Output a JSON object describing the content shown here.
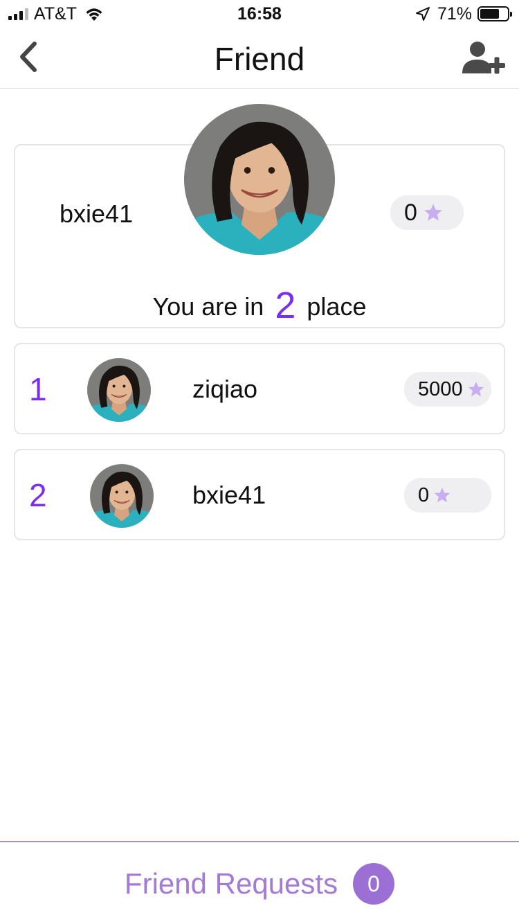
{
  "status_bar": {
    "carrier": "AT&T",
    "time": "16:58",
    "battery_percent": "71%",
    "battery_level": 0.71,
    "signal_icon": "signal-bars-icon",
    "wifi_icon": "wifi-icon",
    "location_icon": "location-arrow-icon",
    "battery_icon": "battery-icon"
  },
  "nav": {
    "title": "Friend",
    "back_icon": "chevron-left-icon",
    "add_icon": "add-user-icon"
  },
  "me": {
    "name": "bxie41",
    "score": "0",
    "place_prefix": "You are in",
    "place_rank": "2",
    "place_suffix": "place"
  },
  "leaderboard": [
    {
      "rank": "1",
      "name": "ziqiao",
      "score": "5000"
    },
    {
      "rank": "2",
      "name": "bxie41",
      "score": "0"
    }
  ],
  "footer": {
    "label": "Friend Requests",
    "count": "0"
  },
  "colors": {
    "accent": "#7a2ef0",
    "star": "#c6aef0",
    "footer_text": "#a37ad6",
    "footer_badge": "#9c6fd4",
    "pill_bg": "#efeff1"
  }
}
